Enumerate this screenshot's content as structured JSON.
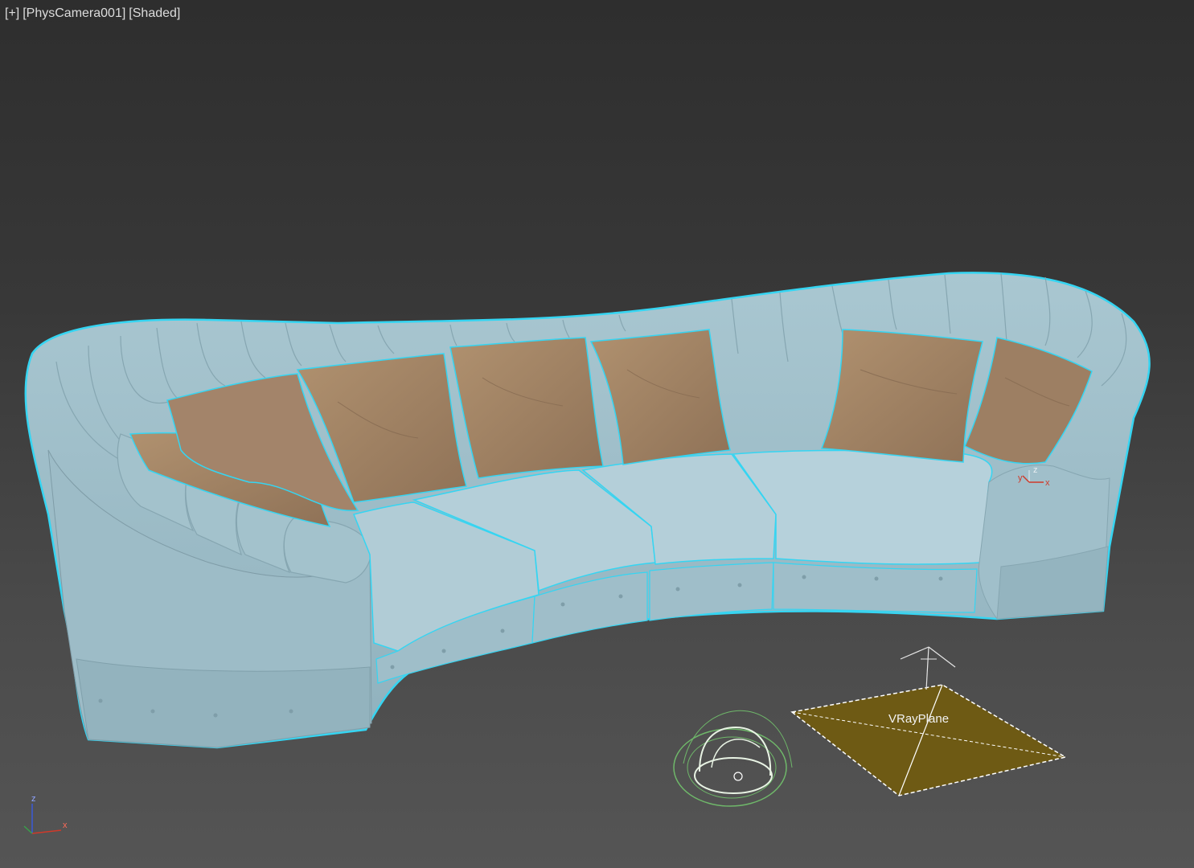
{
  "viewport": {
    "menu_plus": "[+]",
    "camera_label": "[PhysCamera001]",
    "shading_label": "[Shaded]"
  },
  "scene": {
    "vray_plane_label": "VRayPlane",
    "sofa_pivot_axis_z": "z",
    "sofa_pivot_axis_x": "x",
    "sofa_pivot_axis_y": "y"
  },
  "axis_gizmo": {
    "z_label": "z",
    "x_label": "x"
  },
  "colors": {
    "sofa_fill": "#a9c6d0",
    "sofa_shade": "#8eaeb9",
    "sofa_dark": "#7f9ca7",
    "selection_outline": "#35d5f2",
    "pillow_fill": "#a98a6c",
    "pillow_shade": "#927559",
    "vray_plane_fill": "#6e5a14",
    "dome_light_green": "#6fb86a",
    "axis_x": "#d03a2a",
    "axis_y": "#3aa04a",
    "axis_z": "#3a5ad8"
  }
}
